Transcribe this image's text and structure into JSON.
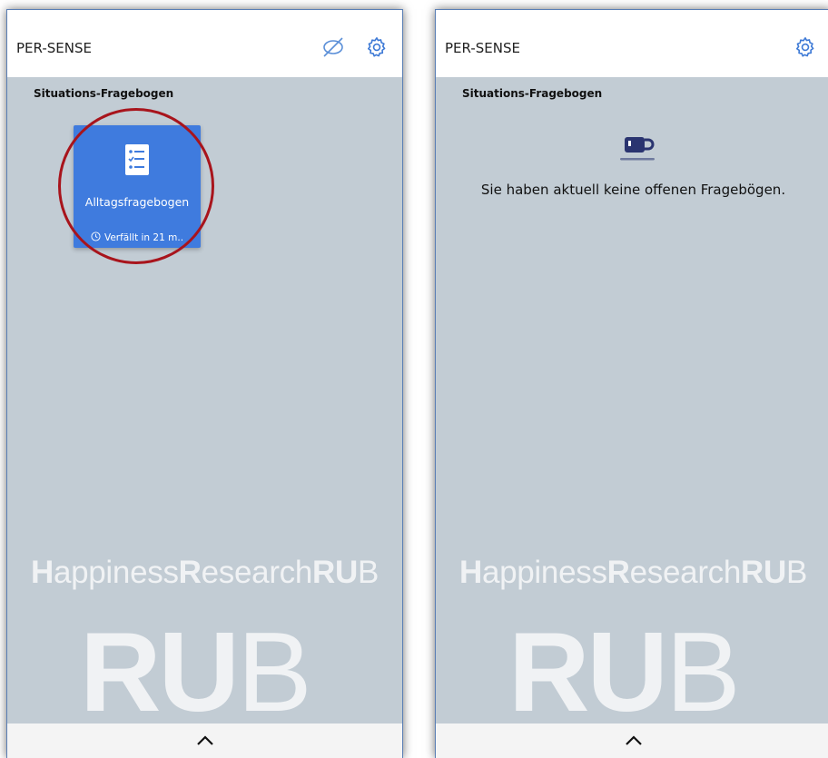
{
  "left_screen": {
    "app_title": "PER-SENSE",
    "icons": {
      "reminder_off": "eye-off-icon",
      "settings": "gear-icon"
    },
    "section_title": "Situations-Fragebogen",
    "questionnaire_card": {
      "icon": "checklist-icon",
      "title": "Alltagsfragebogen",
      "expiry": "Verfällt in 21 m..",
      "background_color": "#3f7bde"
    },
    "annotation_color": "#a8141c",
    "watermark": {
      "part1": "H",
      "part2": "appiness",
      "part3": "R",
      "part4": "esearch",
      "part5": "RU",
      "part6": "B"
    },
    "logo": {
      "bold": "RU",
      "light": "B"
    },
    "bottom_bar": {
      "icon": "chevron-up-icon"
    }
  },
  "right_screen": {
    "app_title": "PER-SENSE",
    "icons": {
      "settings": "gear-icon"
    },
    "section_title": "Situations-Fragebogen",
    "empty_state": {
      "icon": "coffee-cup-icon",
      "icon_color": "#2a3470",
      "message": "Sie haben aktuell keine offenen Fragebögen."
    },
    "watermark": {
      "part1": "H",
      "part2": "appiness",
      "part3": "R",
      "part4": "esearch",
      "part5": "RU",
      "part6": "B"
    },
    "logo": {
      "bold": "RU",
      "light": "B"
    },
    "bottom_bar": {
      "icon": "chevron-up-icon"
    }
  }
}
